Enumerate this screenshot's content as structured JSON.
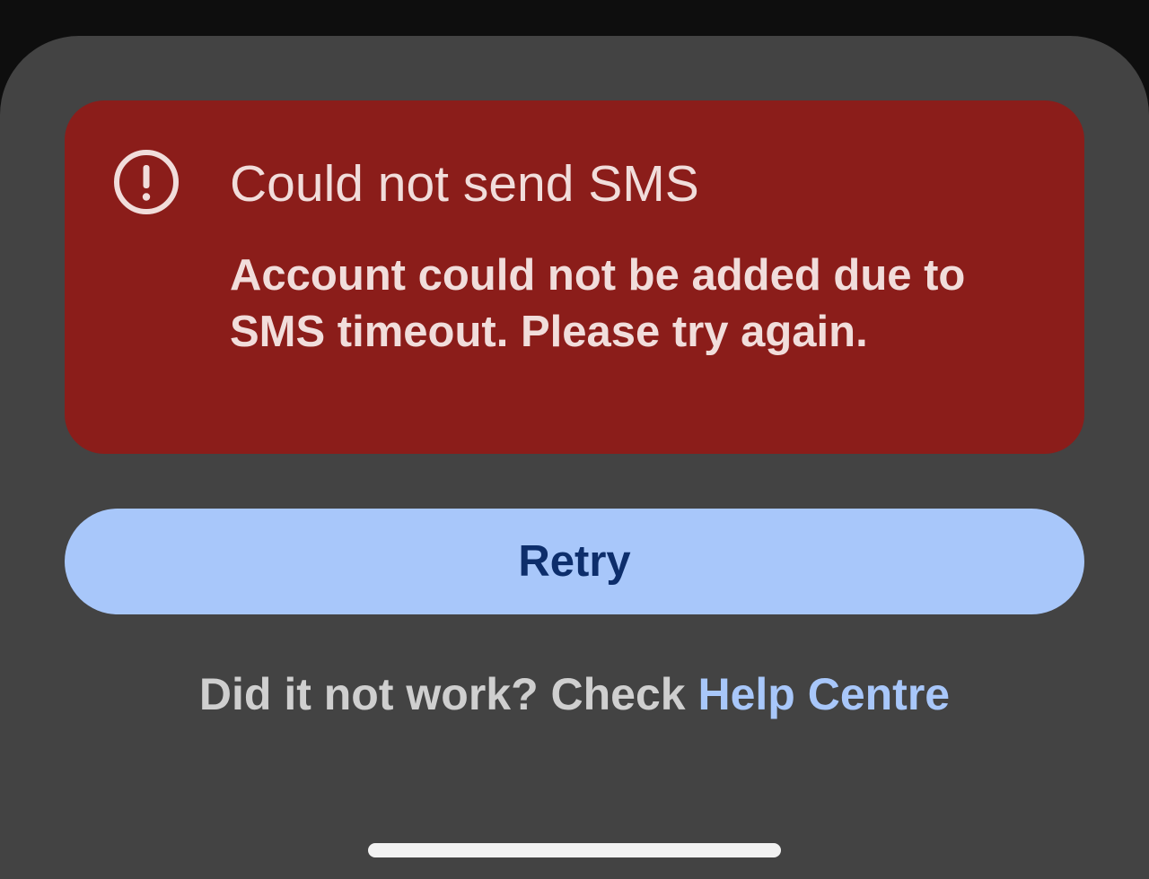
{
  "error": {
    "icon": "alert-circle-icon",
    "title": "Could not send SMS",
    "message": "Account could not be added due to SMS timeout. Please try again.",
    "background_color": "#8b1d1a",
    "text_color": "#f1dddb"
  },
  "retry": {
    "label": "Retry",
    "background_color": "#a8c7fa",
    "text_color": "#0d2e6b"
  },
  "help": {
    "prompt": "Did it not work? Check ",
    "link_label": "Help Centre",
    "link_color": "#a8c7fa"
  }
}
